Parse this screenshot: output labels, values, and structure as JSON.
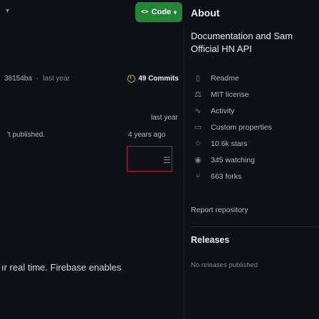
{
  "header": {
    "code_button": "Code",
    "about_title": "About"
  },
  "commit_bar": {
    "hash": "38154ba",
    "separator": "·",
    "time": "last year",
    "commits": "49 Commits"
  },
  "files": {
    "row1_time": "last year",
    "row2_message": "'t published.",
    "row2_time": "4 years ago",
    "bottom_text": "ır real time. Firebase enables"
  },
  "about": {
    "description_line1": "Documentation and Sam",
    "description_line2": "Official HN API",
    "items": [
      {
        "icon": "book-icon",
        "glyph": "▯",
        "label": "Readme"
      },
      {
        "icon": "law-icon",
        "glyph": "⚖",
        "label": "MIT license"
      },
      {
        "icon": "pulse-icon",
        "glyph": "∿",
        "label": "Activity"
      },
      {
        "icon": "note-icon",
        "glyph": "▭",
        "label": "Custom properties"
      },
      {
        "icon": "star-icon",
        "glyph": "☆",
        "label": "10.6k stars"
      },
      {
        "icon": "eye-icon",
        "glyph": "◉",
        "label": "345 watching"
      },
      {
        "icon": "fork-icon",
        "glyph": "⑂",
        "label": "663 forks"
      }
    ],
    "report": "Report repository",
    "releases_title": "Releases",
    "no_releases": "No releases published"
  },
  "colors": {
    "background": "#0d1117",
    "code_button": "#238636",
    "commits_clock": "#d29922",
    "highlight_border": "#b62324"
  }
}
